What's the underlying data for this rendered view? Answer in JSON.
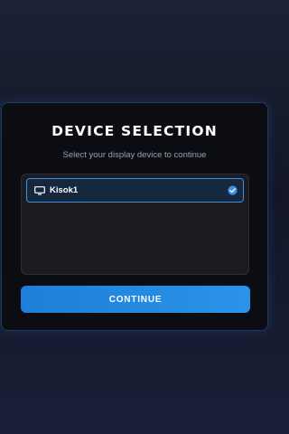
{
  "dialog": {
    "title": "DEVICE SELECTION",
    "subtitle": "Select your display device to continue"
  },
  "devices": [
    {
      "label": "Kisok1",
      "icon": "monitor-icon",
      "selected": true
    }
  ],
  "actions": {
    "continue_label": "CONTINUE"
  },
  "colors": {
    "accent": "#2a93ea",
    "selected_border": "#3a8fe0",
    "dialog_bg": "#0b0d13",
    "page_bg": "#161b2c"
  }
}
